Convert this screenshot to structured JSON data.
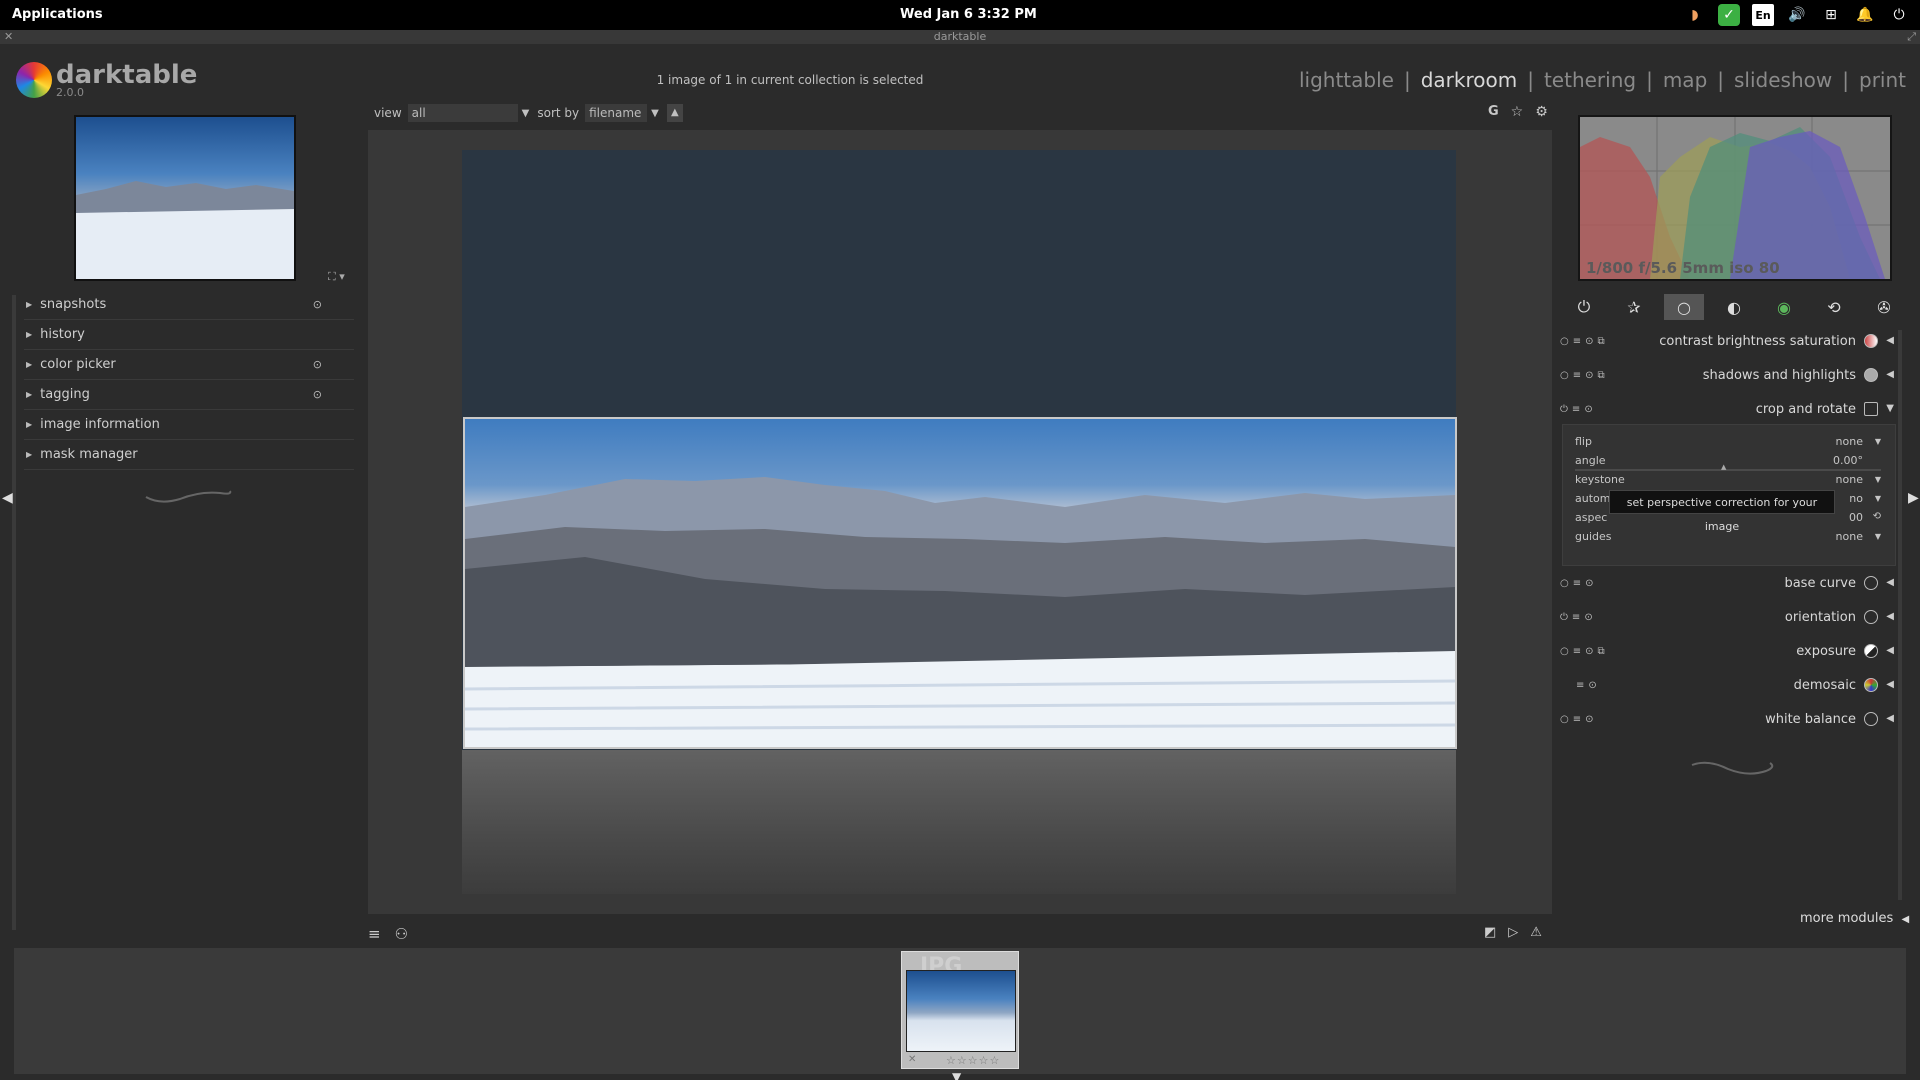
{
  "system_bar": {
    "applications": "Applications",
    "datetime": "Wed Jan  6    3:32 PM",
    "tray_icons": [
      "night-light-icon",
      "check-shield-icon",
      "keyboard-layout-icon",
      "volume-icon",
      "network-icon",
      "notifications-icon",
      "power-icon"
    ],
    "keyboard_layout": "En"
  },
  "window": {
    "title": "darktable"
  },
  "app": {
    "name": "darktable",
    "version": "2.0.0"
  },
  "header": {
    "collection_status": "1 image of 1 in current collection is selected",
    "views": [
      "lighttable",
      "darkroom",
      "tethering",
      "map",
      "slideshow",
      "print"
    ],
    "active_view": "darkroom",
    "separator": "|"
  },
  "toolbar": {
    "view_label": "view",
    "view_value": "all",
    "sort_label": "sort by",
    "sort_value": "filename",
    "sort_dir": "▲",
    "grouping_label": "G"
  },
  "left_modules": [
    {
      "label": "snapshots",
      "pin": true
    },
    {
      "label": "history",
      "pin": false
    },
    {
      "label": "color picker",
      "pin": true
    },
    {
      "label": "tagging",
      "pin": true
    },
    {
      "label": "image information",
      "pin": false
    },
    {
      "label": "mask manager",
      "pin": false
    }
  ],
  "histogram": {
    "exif": "1/800 f/5.6 5mm iso 80"
  },
  "module_groups": [
    "power-icon",
    "favorites-icon",
    "basic-group-icon",
    "tone-group-icon",
    "color-group-icon",
    "correct-group-icon",
    "effect-group-icon"
  ],
  "active_group_index": 2,
  "right_modules": [
    {
      "label": "contrast brightness saturation",
      "icon": "contrast-icon"
    },
    {
      "label": "shadows and highlights",
      "icon": "shadows-icon"
    },
    {
      "label": "crop and rotate",
      "icon": "crop-icon",
      "expanded": true
    },
    {
      "label": "base curve",
      "icon": "curve-icon"
    },
    {
      "label": "orientation",
      "icon": "orientation-icon"
    },
    {
      "label": "exposure",
      "icon": "exposure-icon"
    },
    {
      "label": "demosaic",
      "icon": "demosaic-icon"
    },
    {
      "label": "white balance",
      "icon": "white-balance-icon"
    }
  ],
  "crop_params": {
    "flip_label": "flip",
    "flip_value": "none",
    "angle_label": "angle",
    "angle_value": "0.00°",
    "keystone_label": "keystone",
    "keystone_value": "none",
    "automatic_label": "autom",
    "automatic_value": "no",
    "aspect_label": "aspec",
    "aspect_value": "00",
    "guides_label": "guides",
    "guides_value": "none"
  },
  "tooltip": "set perspective correction for your image",
  "more_modules": "more modules",
  "filmstrip": {
    "ext_label": "JPG",
    "stars": "☆☆☆☆☆"
  }
}
